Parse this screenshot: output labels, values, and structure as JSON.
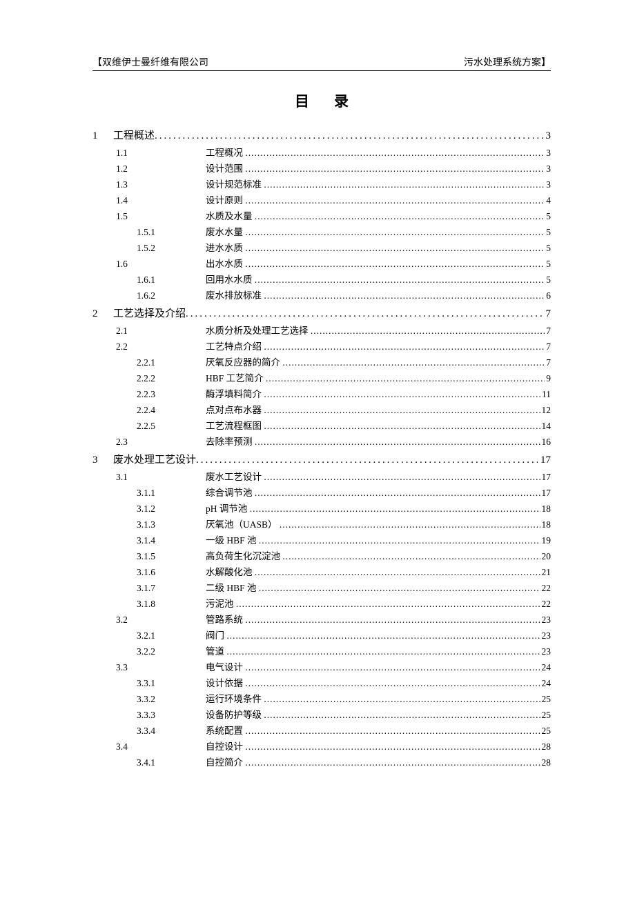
{
  "header": {
    "left": "【双维伊士曼纤维有限公司",
    "right": "污水处理系统方案】"
  },
  "title": {
    "a": "目",
    "b": "录"
  },
  "toc": [
    {
      "lvl": 1,
      "num": "1",
      "txt": "工程概述",
      "pg": "3"
    },
    {
      "lvl": 2,
      "num": "1.1",
      "txt": "工程概况",
      "pg": "3"
    },
    {
      "lvl": 2,
      "num": "1.2",
      "txt": "设计范围",
      "pg": "3"
    },
    {
      "lvl": 2,
      "num": "1.3",
      "txt": "设计规范标准",
      "pg": "3"
    },
    {
      "lvl": 2,
      "num": "1.4",
      "txt": "设计原则",
      "pg": "4"
    },
    {
      "lvl": 2,
      "num": "1.5",
      "txt": "水质及水量",
      "pg": "5"
    },
    {
      "lvl": 3,
      "num": "1.5.1",
      "txt": "废水水量",
      "pg": "5"
    },
    {
      "lvl": 3,
      "num": "1.5.2",
      "txt": "进水水质",
      "pg": "5"
    },
    {
      "lvl": 2,
      "num": "1.6",
      "txt": "出水水质",
      "pg": "5"
    },
    {
      "lvl": 3,
      "num": "1.6.1",
      "txt": "回用水水质",
      "pg": "5"
    },
    {
      "lvl": 3,
      "num": "1.6.2",
      "txt": "废水排放标准",
      "pg": "6"
    },
    {
      "lvl": 1,
      "num": "2",
      "txt": "工艺选择及介绍",
      "pg": "7"
    },
    {
      "lvl": 2,
      "num": "2.1",
      "txt": "水质分析及处理工艺选择",
      "pg": "7"
    },
    {
      "lvl": 2,
      "num": "2.2",
      "txt": "工艺特点介绍",
      "pg": "7"
    },
    {
      "lvl": 3,
      "num": "2.2.1",
      "txt": "厌氧反应器的简介",
      "pg": "7"
    },
    {
      "lvl": 3,
      "num": "2.2.2",
      "txt": "HBF 工艺简介",
      "pg": "9"
    },
    {
      "lvl": 3,
      "num": "2.2.3",
      "txt": "酶浮填料简介",
      "pg": "11"
    },
    {
      "lvl": 3,
      "num": "2.2.4",
      "txt": "点对点布水器",
      "pg": "12"
    },
    {
      "lvl": 3,
      "num": "2.2.5",
      "txt": "工艺流程框图",
      "pg": "14"
    },
    {
      "lvl": 2,
      "num": "2.3",
      "txt": "去除率预测",
      "pg": "16"
    },
    {
      "lvl": 1,
      "num": "3",
      "txt": "废水处理工艺设计",
      "pg": "17"
    },
    {
      "lvl": 2,
      "num": "3.1",
      "txt": "废水工艺设计",
      "pg": "17"
    },
    {
      "lvl": 3,
      "num": "3.1.1",
      "txt": "综合调节池",
      "pg": "17"
    },
    {
      "lvl": 3,
      "num": "3.1.2",
      "txt": "pH 调节池",
      "pg": "18"
    },
    {
      "lvl": 3,
      "num": "3.1.3",
      "txt": "厌氧池（UASB）",
      "pg": "18"
    },
    {
      "lvl": 3,
      "num": "3.1.4",
      "txt": "一级 HBF 池",
      "pg": "19"
    },
    {
      "lvl": 3,
      "num": "3.1.5",
      "txt": "高负荷生化沉淀池",
      "pg": "20"
    },
    {
      "lvl": 3,
      "num": "3.1.6",
      "txt": "水解酸化池",
      "pg": "21"
    },
    {
      "lvl": 3,
      "num": "3.1.7",
      "txt": "二级 HBF 池",
      "pg": "22"
    },
    {
      "lvl": 3,
      "num": "3.1.8",
      "txt": "污泥池",
      "pg": "22"
    },
    {
      "lvl": 2,
      "num": "3.2",
      "txt": "管路系统",
      "pg": "23"
    },
    {
      "lvl": 3,
      "num": "3.2.1",
      "txt": "阀门",
      "pg": "23"
    },
    {
      "lvl": 3,
      "num": "3.2.2",
      "txt": "管道",
      "pg": "23"
    },
    {
      "lvl": 2,
      "num": "3.3",
      "txt": "电气设计",
      "pg": "24"
    },
    {
      "lvl": 3,
      "num": "3.3.1",
      "txt": "设计依据",
      "pg": "24"
    },
    {
      "lvl": 3,
      "num": "3.3.2",
      "txt": "运行环境条件",
      "pg": "25"
    },
    {
      "lvl": 3,
      "num": "3.3.3",
      "txt": "设备防护等级",
      "pg": "25"
    },
    {
      "lvl": 3,
      "num": "3.3.4",
      "txt": "系统配置",
      "pg": "25"
    },
    {
      "lvl": 2,
      "num": "3.4",
      "txt": "自控设计",
      "pg": "28"
    },
    {
      "lvl": 3,
      "num": "3.4.1",
      "txt": "自控简介",
      "pg": "28"
    }
  ]
}
